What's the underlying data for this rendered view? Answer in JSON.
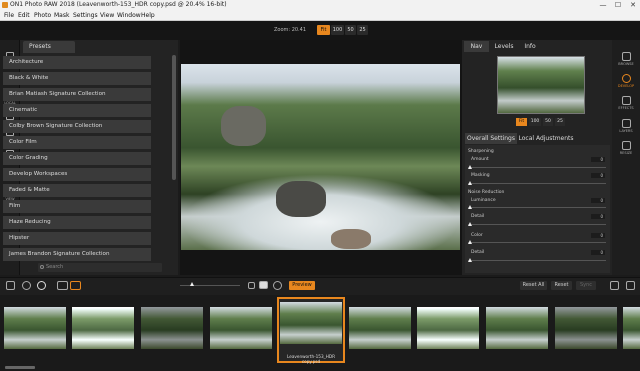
{
  "window": {
    "title": "ON1 Photo RAW 2018 (Leavenworth-153_HDR copy.psd @ 20.4% 16-bit)",
    "controls": [
      "—",
      "☐",
      "✕"
    ]
  },
  "menu": [
    "File",
    "Edit",
    "Photo",
    "Mask",
    "Settings",
    "View",
    "Window",
    "Help"
  ],
  "zoom": {
    "label": "Zoom: 20.41",
    "buttons": [
      "Fit",
      "100",
      "50",
      "25"
    ],
    "active": "Fit"
  },
  "left_tools": [
    {
      "name": "crop",
      "label": "CROP"
    },
    {
      "name": "transform",
      "label": ""
    },
    {
      "name": "local",
      "label": "LOCAL"
    },
    {
      "name": "brush",
      "label": ""
    },
    {
      "name": "erase",
      "label": ""
    },
    {
      "name": "fix",
      "label": "FIX"
    },
    {
      "name": "view",
      "label": "VIEW"
    }
  ],
  "presets": {
    "tab_label": "Presets",
    "items": [
      "Architecture",
      "Black & White",
      "Brian Matiash Signature Collection",
      "Cinematic",
      "Colby Brown Signature Collection",
      "Color Film",
      "Color Grading",
      "Develop Workspaces",
      "Faded & Matte",
      "Film",
      "Haze Reducing",
      "Hipster",
      "James Brandon Signature Collection"
    ],
    "search_placeholder": "Search"
  },
  "right": {
    "nav_tabs": [
      "Nav",
      "Levels",
      "Info"
    ],
    "nav_zoom": [
      "Fit",
      "100",
      "50",
      "25"
    ],
    "adjust_tabs": [
      "Overall Settings",
      "Local Adjustments"
    ],
    "sections": {
      "sharpening": "Sharpening",
      "noise_reduction": "Noise Reduction"
    },
    "params": [
      {
        "label": "Amount",
        "value": "0"
      },
      {
        "label": "Masking",
        "value": "0"
      },
      {
        "label": "Luminance",
        "value": "0"
      },
      {
        "label": "Detail",
        "value": "0"
      },
      {
        "label": "Color",
        "value": "0"
      },
      {
        "label": "Detail",
        "value": "0"
      }
    ]
  },
  "modules": [
    {
      "label": "BROWSE",
      "active": false
    },
    {
      "label": "DEVELOP",
      "active": true
    },
    {
      "label": "EFFECTS",
      "active": false
    },
    {
      "label": "LAYERS",
      "active": false
    },
    {
      "label": "RESIZE",
      "active": false
    }
  ],
  "bottom": {
    "preview_label": "Preview",
    "reset_all": "Reset All",
    "reset": "Reset",
    "sync": "Sync"
  },
  "filmstrip": {
    "selected_name": "Leavenworth-153_HDR copy.psd",
    "count": 10,
    "selected_index": 4
  },
  "colors": {
    "accent": "#e8871e"
  }
}
